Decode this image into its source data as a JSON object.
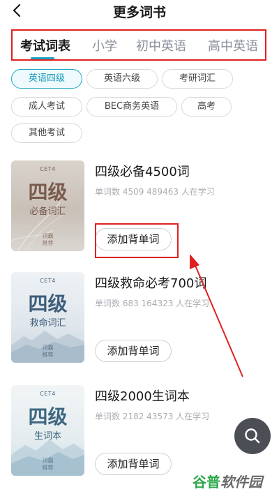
{
  "header": {
    "title": "更多词书",
    "back_icon": "chevron-left-icon"
  },
  "tabs": [
    {
      "label": "考试词表",
      "active": true
    },
    {
      "label": "小学",
      "active": false
    },
    {
      "label": "初中英语",
      "active": false
    },
    {
      "label": "高中英语",
      "active": false
    }
  ],
  "filters": [
    {
      "label": "英语四级",
      "active": true
    },
    {
      "label": "英语六级",
      "active": false
    },
    {
      "label": "考研词汇",
      "active": false
    },
    {
      "label": "成人考试",
      "active": false
    },
    {
      "label": "BEC商务英语",
      "active": false
    },
    {
      "label": "高考",
      "active": false
    },
    {
      "label": "其他考试",
      "active": false
    }
  ],
  "books": [
    {
      "title": "四级必备4500词",
      "stats": "单词数 4509  489463 人在学习",
      "button": "添加背单词",
      "cover": {
        "tag": "CET4",
        "big": "四级",
        "sub": "必备词汇",
        "rec": "词霸\n推荐"
      }
    },
    {
      "title": "四级救命必考700词",
      "stats": "单词数 683  164323 人在学习",
      "button": "添加背单词",
      "cover": {
        "tag": "CET4",
        "big": "四级",
        "sub": "救命词汇",
        "rec": "词霸\n推荐"
      }
    },
    {
      "title": "四级2000生词本",
      "stats": "单词数 2182  43573 人在学习",
      "button": "添加背单词",
      "cover": {
        "tag": "CET4",
        "big": "四级",
        "sub": "生词本",
        "rec": "词霸\n推荐"
      }
    }
  ],
  "fab": {
    "icon": "search-icon"
  },
  "watermark": {
    "part1": "谷普",
    "part2": "软件园"
  },
  "colors": {
    "accent": "#1aa6c4",
    "annotation": "#e02020",
    "fab": "#4b4f55"
  }
}
